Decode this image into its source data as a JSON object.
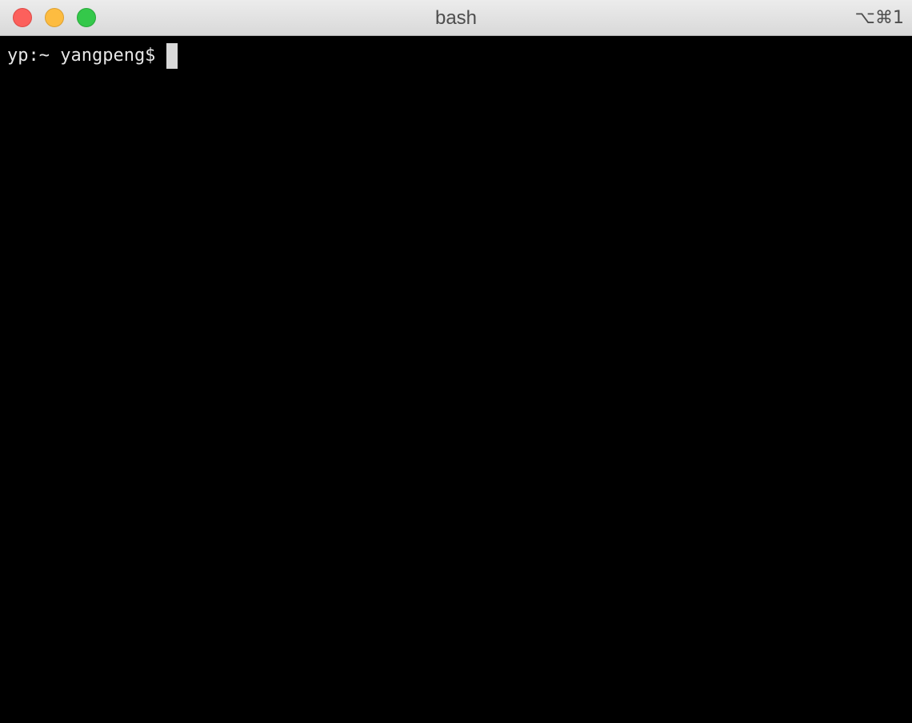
{
  "window": {
    "title": "bash",
    "shortcut": "⌥⌘1",
    "colors": {
      "close": "#fc605c",
      "minimize": "#fdbc40",
      "zoom": "#34c84a",
      "terminal_bg": "#000000",
      "terminal_fg": "#e6e6e6"
    }
  },
  "terminal": {
    "prompt": "yp:~ yangpeng$"
  }
}
